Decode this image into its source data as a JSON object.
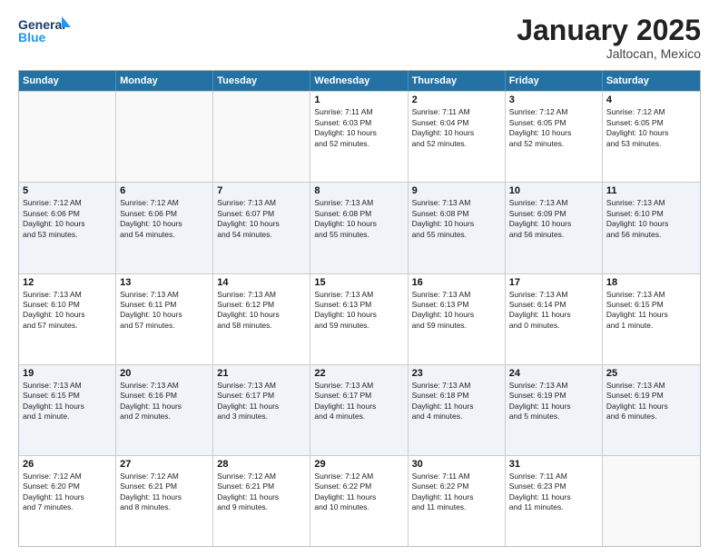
{
  "header": {
    "logo_line1": "General",
    "logo_line2": "Blue",
    "month_title": "January 2025",
    "subtitle": "Jaltocan, Mexico"
  },
  "weekdays": [
    "Sunday",
    "Monday",
    "Tuesday",
    "Wednesday",
    "Thursday",
    "Friday",
    "Saturday"
  ],
  "rows": [
    [
      {
        "day": "",
        "text": "",
        "empty": true
      },
      {
        "day": "",
        "text": "",
        "empty": true
      },
      {
        "day": "",
        "text": "",
        "empty": true
      },
      {
        "day": "1",
        "text": "Sunrise: 7:11 AM\nSunset: 6:03 PM\nDaylight: 10 hours\nand 52 minutes."
      },
      {
        "day": "2",
        "text": "Sunrise: 7:11 AM\nSunset: 6:04 PM\nDaylight: 10 hours\nand 52 minutes."
      },
      {
        "day": "3",
        "text": "Sunrise: 7:12 AM\nSunset: 6:05 PM\nDaylight: 10 hours\nand 52 minutes."
      },
      {
        "day": "4",
        "text": "Sunrise: 7:12 AM\nSunset: 6:05 PM\nDaylight: 10 hours\nand 53 minutes."
      }
    ],
    [
      {
        "day": "5",
        "text": "Sunrise: 7:12 AM\nSunset: 6:06 PM\nDaylight: 10 hours\nand 53 minutes."
      },
      {
        "day": "6",
        "text": "Sunrise: 7:12 AM\nSunset: 6:06 PM\nDaylight: 10 hours\nand 54 minutes."
      },
      {
        "day": "7",
        "text": "Sunrise: 7:13 AM\nSunset: 6:07 PM\nDaylight: 10 hours\nand 54 minutes."
      },
      {
        "day": "8",
        "text": "Sunrise: 7:13 AM\nSunset: 6:08 PM\nDaylight: 10 hours\nand 55 minutes."
      },
      {
        "day": "9",
        "text": "Sunrise: 7:13 AM\nSunset: 6:08 PM\nDaylight: 10 hours\nand 55 minutes."
      },
      {
        "day": "10",
        "text": "Sunrise: 7:13 AM\nSunset: 6:09 PM\nDaylight: 10 hours\nand 56 minutes."
      },
      {
        "day": "11",
        "text": "Sunrise: 7:13 AM\nSunset: 6:10 PM\nDaylight: 10 hours\nand 56 minutes."
      }
    ],
    [
      {
        "day": "12",
        "text": "Sunrise: 7:13 AM\nSunset: 6:10 PM\nDaylight: 10 hours\nand 57 minutes."
      },
      {
        "day": "13",
        "text": "Sunrise: 7:13 AM\nSunset: 6:11 PM\nDaylight: 10 hours\nand 57 minutes."
      },
      {
        "day": "14",
        "text": "Sunrise: 7:13 AM\nSunset: 6:12 PM\nDaylight: 10 hours\nand 58 minutes."
      },
      {
        "day": "15",
        "text": "Sunrise: 7:13 AM\nSunset: 6:13 PM\nDaylight: 10 hours\nand 59 minutes."
      },
      {
        "day": "16",
        "text": "Sunrise: 7:13 AM\nSunset: 6:13 PM\nDaylight: 10 hours\nand 59 minutes."
      },
      {
        "day": "17",
        "text": "Sunrise: 7:13 AM\nSunset: 6:14 PM\nDaylight: 11 hours\nand 0 minutes."
      },
      {
        "day": "18",
        "text": "Sunrise: 7:13 AM\nSunset: 6:15 PM\nDaylight: 11 hours\nand 1 minute."
      }
    ],
    [
      {
        "day": "19",
        "text": "Sunrise: 7:13 AM\nSunset: 6:15 PM\nDaylight: 11 hours\nand 1 minute."
      },
      {
        "day": "20",
        "text": "Sunrise: 7:13 AM\nSunset: 6:16 PM\nDaylight: 11 hours\nand 2 minutes."
      },
      {
        "day": "21",
        "text": "Sunrise: 7:13 AM\nSunset: 6:17 PM\nDaylight: 11 hours\nand 3 minutes."
      },
      {
        "day": "22",
        "text": "Sunrise: 7:13 AM\nSunset: 6:17 PM\nDaylight: 11 hours\nand 4 minutes."
      },
      {
        "day": "23",
        "text": "Sunrise: 7:13 AM\nSunset: 6:18 PM\nDaylight: 11 hours\nand 4 minutes."
      },
      {
        "day": "24",
        "text": "Sunrise: 7:13 AM\nSunset: 6:19 PM\nDaylight: 11 hours\nand 5 minutes."
      },
      {
        "day": "25",
        "text": "Sunrise: 7:13 AM\nSunset: 6:19 PM\nDaylight: 11 hours\nand 6 minutes."
      }
    ],
    [
      {
        "day": "26",
        "text": "Sunrise: 7:12 AM\nSunset: 6:20 PM\nDaylight: 11 hours\nand 7 minutes."
      },
      {
        "day": "27",
        "text": "Sunrise: 7:12 AM\nSunset: 6:21 PM\nDaylight: 11 hours\nand 8 minutes."
      },
      {
        "day": "28",
        "text": "Sunrise: 7:12 AM\nSunset: 6:21 PM\nDaylight: 11 hours\nand 9 minutes."
      },
      {
        "day": "29",
        "text": "Sunrise: 7:12 AM\nSunset: 6:22 PM\nDaylight: 11 hours\nand 10 minutes."
      },
      {
        "day": "30",
        "text": "Sunrise: 7:11 AM\nSunset: 6:22 PM\nDaylight: 11 hours\nand 11 minutes."
      },
      {
        "day": "31",
        "text": "Sunrise: 7:11 AM\nSunset: 6:23 PM\nDaylight: 11 hours\nand 11 minutes."
      },
      {
        "day": "",
        "text": "",
        "empty": true
      }
    ]
  ]
}
